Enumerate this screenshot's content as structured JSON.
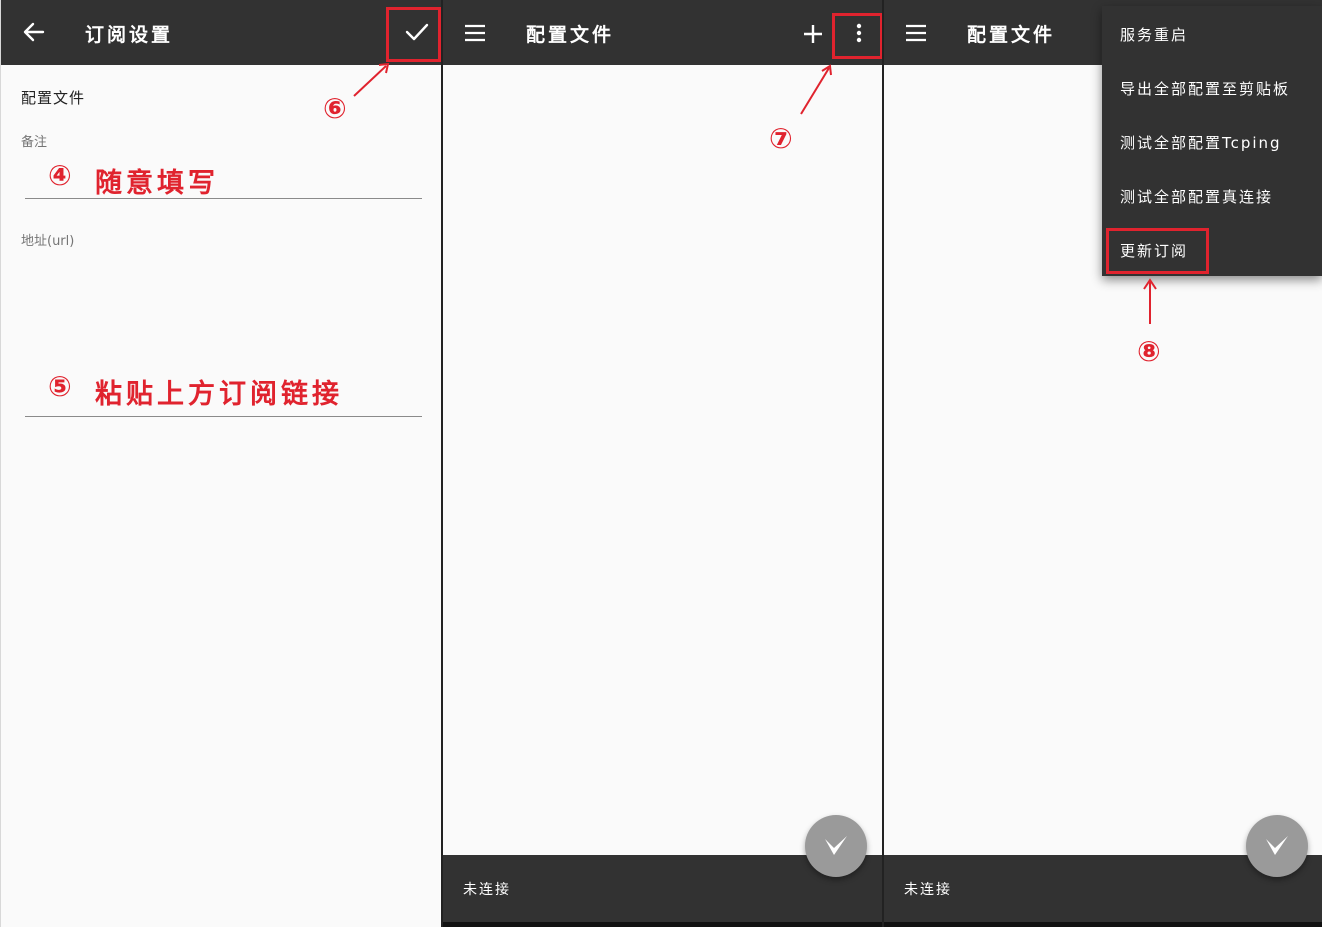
{
  "panel1": {
    "title": "订阅设置",
    "section_title": "配置文件",
    "remark_label": "备注",
    "url_label": "地址(url)",
    "annotation_remark_num": "④",
    "annotation_remark": "随意填写",
    "annotation_url_num": "⑤",
    "annotation_url": "粘贴上方订阅链接",
    "annotation_save_num": "⑥",
    "icons": {
      "back": "arrow-left-icon",
      "save": "check-icon"
    }
  },
  "panel2": {
    "title": "配置文件",
    "status": "未连接",
    "annotation_more_num": "⑦",
    "icons": {
      "menu": "hamburger-menu-icon",
      "add": "plus-icon",
      "more": "more-vert-icon",
      "fab": "v-logo-icon"
    }
  },
  "panel3": {
    "title": "配置文件",
    "status": "未连接",
    "annotation_update_num": "⑧",
    "menu_items": [
      "服务重启",
      "导出全部配置至剪贴板",
      "测试全部配置Tcping",
      "测试全部配置真连接",
      "更新订阅"
    ],
    "icons": {
      "menu": "hamburger-menu-icon",
      "fab": "v-logo-icon"
    }
  },
  "colors": {
    "toolbar": "#323232",
    "background": "#fafafa",
    "annotation_red": "#e0232e",
    "fab": "#9a9a9a"
  }
}
